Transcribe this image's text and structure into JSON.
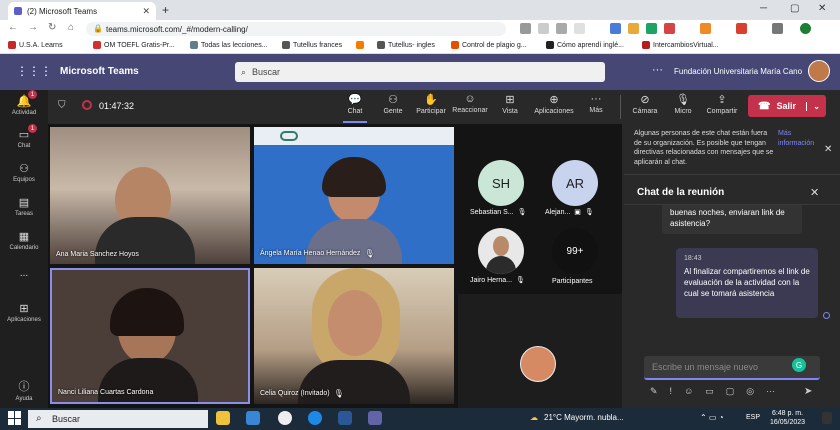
{
  "browser": {
    "tab_title": "(2) Microsoft Teams",
    "url": "teams.microsoft.com/_#/modern-calling/",
    "bookmarks": [
      "U.S.A. Learns",
      "OM TOEFL Gratis-Pr...",
      "Todas las lecciones...",
      "Tutellus frances",
      "",
      "Tutellus- ingles",
      "Control de plagio g...",
      "Cómo aprendí inglé...",
      "IntercambiosVirtual..."
    ]
  },
  "teams": {
    "app_name": "Microsoft Teams",
    "search_placeholder": "Buscar",
    "org_name": "Fundación Universitaria María Cano"
  },
  "rail": [
    {
      "label": "Actividad",
      "badge": "1",
      "icon": "bell-icon"
    },
    {
      "label": "Chat",
      "badge": "1",
      "icon": "chat-icon"
    },
    {
      "label": "Equipos",
      "badge": "",
      "icon": "teams-icon"
    },
    {
      "label": "Tareas",
      "badge": "",
      "icon": "assignments-icon"
    },
    {
      "label": "Calendario",
      "badge": "",
      "icon": "calendar-icon"
    },
    {
      "label": "...",
      "badge": "",
      "icon": "more-icon"
    },
    {
      "label": "Aplicaciones",
      "badge": "",
      "icon": "apps-icon"
    },
    {
      "label": "Ayuda",
      "badge": "",
      "icon": "help-icon"
    }
  ],
  "meeting": {
    "timer": "01:47:32",
    "toolbar": [
      "Chat",
      "Gente",
      "Participar",
      "Reaccionar",
      "Vista",
      "Aplicaciones",
      "Más",
      "Cámara",
      "Micro",
      "Compartir"
    ],
    "leave_label": "Salir"
  },
  "participants": {
    "tiles": [
      "Ana Maria Sanchez Hoyos",
      "Ángela María Henao Hernández",
      "Nanci Liliana Cuartas Cardona",
      "Celia Quiroz (Invitado)"
    ],
    "side": [
      {
        "initials": "SH",
        "name": "Sebastian S..."
      },
      {
        "initials": "AR",
        "name": "Alejan..."
      },
      {
        "initials": "",
        "name": "Jairo Herna..."
      },
      {
        "initials": "99+",
        "name": "Participantes"
      }
    ]
  },
  "chat": {
    "notice": "Algunas personas de este chat están fuera de su organización. Es posible que tengan directivas relacionadas con mensajes que se aplicarán al chat.",
    "notice_link": "Más información",
    "title": "Chat de la reunión",
    "msg1": "buenas noches, enviaran link de asistencia?",
    "msg2_time": "18:43",
    "msg2": "Al finalizar compartiremos el link de evaluación de la actividad con la cual se tomará asistencia",
    "composer_placeholder": "Escribe un mensaje nuevo"
  },
  "taskbar": {
    "search": "Buscar",
    "weather": "21°C  Mayorm. nubla...",
    "lang": "ESP",
    "time": "6:48 p. m.",
    "date": "16/05/2023"
  }
}
